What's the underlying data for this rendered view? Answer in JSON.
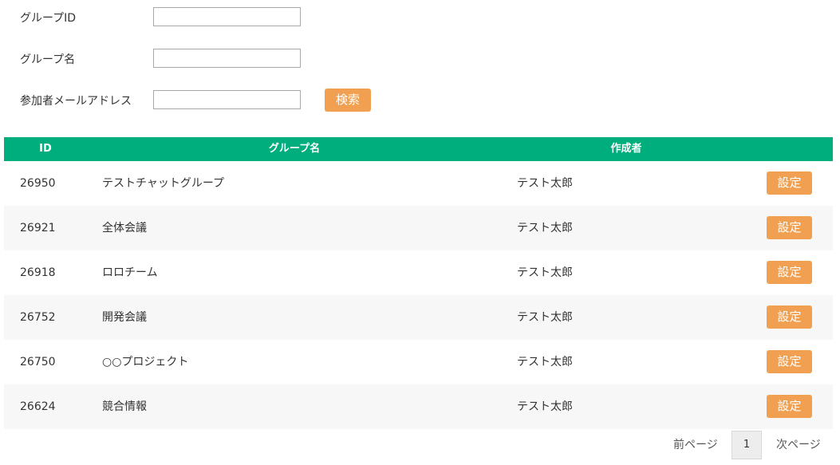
{
  "search": {
    "group_id_label": "グループID",
    "group_id_value": "",
    "group_name_label": "グループ名",
    "group_name_value": "",
    "email_label": "参加者メールアドレス",
    "email_value": "",
    "search_button": "検索",
    "button_color": "#f0a050"
  },
  "table": {
    "header_color": "#00ad7c",
    "headers": {
      "id": "ID",
      "name": "グループ名",
      "creator": "作成者"
    },
    "rows": [
      {
        "id": "26950",
        "name": "テストチャットグループ",
        "creator": "テスト太郎",
        "action": "設定"
      },
      {
        "id": "26921",
        "name": "全体会議",
        "creator": "テスト太郎",
        "action": "設定"
      },
      {
        "id": "26918",
        "name": "ロロチーム",
        "creator": "テスト太郎",
        "action": "設定"
      },
      {
        "id": "26752",
        "name": "開発会議",
        "creator": "テスト太郎",
        "action": "設定"
      },
      {
        "id": "26750",
        "name": "○○プロジェクト",
        "creator": "テスト太郎",
        "action": "設定"
      },
      {
        "id": "26624",
        "name": "競合情報",
        "creator": "テスト太郎",
        "action": "設定"
      }
    ]
  },
  "pagination": {
    "prev": "前ページ",
    "current_page": "1",
    "next": "次ページ"
  }
}
